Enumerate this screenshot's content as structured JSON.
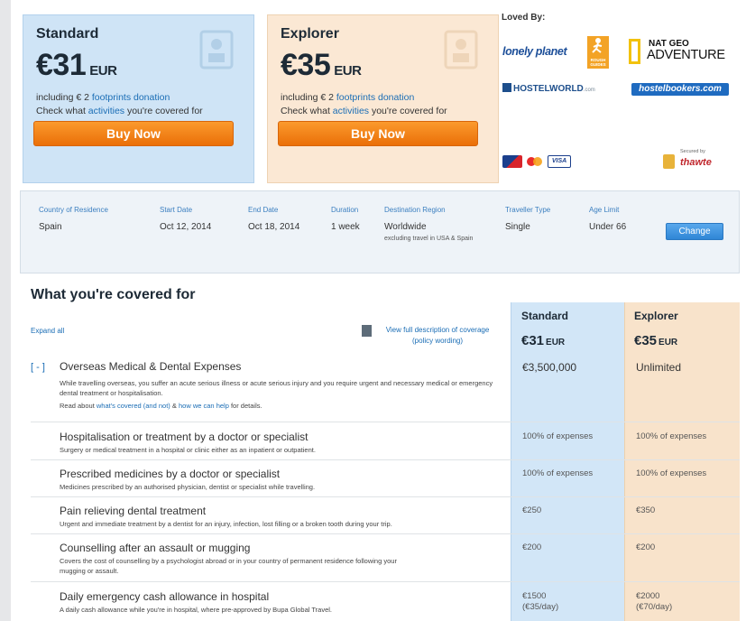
{
  "plans": [
    {
      "name": "Standard",
      "price": "€31",
      "currency": "EUR",
      "donation_prefix": "including € 2",
      "donation_link": "footprints donation",
      "activities_prefix": "Check what",
      "activities_link": "activities",
      "activities_suffix": "you're covered for",
      "buy_label": "Buy Now"
    },
    {
      "name": "Explorer",
      "price": "€35",
      "currency": "EUR",
      "donation_prefix": "including € 2",
      "donation_link": "footprints donation",
      "activities_prefix": "Check what",
      "activities_link": "activities",
      "activities_suffix": "you're covered for",
      "buy_label": "Buy Now"
    }
  ],
  "loved_by": {
    "label": "Loved By:",
    "lonely_planet": "lonely planet",
    "rough_guides": "ROUGH GUIDES",
    "natgeo_top": "NAT GEO",
    "natgeo_bottom": "ADVENTURE",
    "hostelworld": "HOSTELWORLD",
    "hostelworld_suffix": ".com",
    "hostelbookers": "hostelbookers.com"
  },
  "payment": {
    "visa": "VISA",
    "secured_by": "Secured by",
    "thawte": "thawte"
  },
  "trip": {
    "fields": [
      {
        "label": "Country of Residence",
        "value": "Spain"
      },
      {
        "label": "Start Date",
        "value": "Oct 12, 2014"
      },
      {
        "label": "End Date",
        "value": "Oct 18, 2014"
      },
      {
        "label": "Duration",
        "value": "1 week"
      },
      {
        "label": "Destination Region",
        "value": "Worldwide",
        "sub": "excluding travel in USA & Spain"
      },
      {
        "label": "Traveller Type",
        "value": "Single"
      },
      {
        "label": "Age Limit",
        "value": "Under 66"
      }
    ],
    "change_label": "Change"
  },
  "coverage": {
    "title": "What you're covered for",
    "expand_all": "Expand all",
    "view_full": "View full description of coverage (policy wording)",
    "columns": [
      {
        "name": "Standard",
        "price": "€31",
        "currency": "EUR"
      },
      {
        "name": "Explorer",
        "price": "€35",
        "currency": "EUR"
      }
    ],
    "main": {
      "toggle": "[ - ]",
      "title": "Overseas Medical & Dental Expenses",
      "desc": "While travelling overseas, you suffer an acute serious illness or acute serious injury and you require urgent and necessary medical or emergency dental treatment or hospitalisation.",
      "read_prefix": "Read about",
      "read_link1": "what's covered (and not)",
      "read_amp": "&",
      "read_link2": "how we can help",
      "read_suffix": "for details.",
      "standard": "€3,500,000",
      "explorer": "Unlimited"
    },
    "rows": [
      {
        "title": "Hospitalisation or treatment by a doctor or specialist",
        "desc": "Surgery or medical treatment in a hospital or clinic either as an inpatient or outpatient.",
        "standard": "100% of expenses",
        "explorer": "100% of expenses"
      },
      {
        "title": "Prescribed medicines by a doctor or specialist",
        "desc": "Medicines prescribed by an authorised physician, dentist or specialist while travelling.",
        "standard": "100% of expenses",
        "explorer": "100% of expenses"
      },
      {
        "title": "Pain relieving dental treatment",
        "desc": "Urgent and immediate treatment by a dentist for an injury, infection, lost filling or a broken tooth during your trip.",
        "standard": "€250",
        "explorer": "€350"
      },
      {
        "title": "Counselling after an assault or mugging",
        "desc": "Covers the cost of counselling by a psychologist abroad or in your country of permanent residence following your",
        "desc_link": "mugging or assault.",
        "standard": "€200",
        "explorer": "€200"
      },
      {
        "title": "Daily emergency cash allowance in hospital",
        "desc": "A daily cash allowance while you're in hospital, where pre-approved by Bupa Global Travel.",
        "standard": "€1500",
        "standard_sub": "(€35/day)",
        "explorer": "€2000",
        "explorer_sub": "(€70/day)"
      }
    ]
  }
}
